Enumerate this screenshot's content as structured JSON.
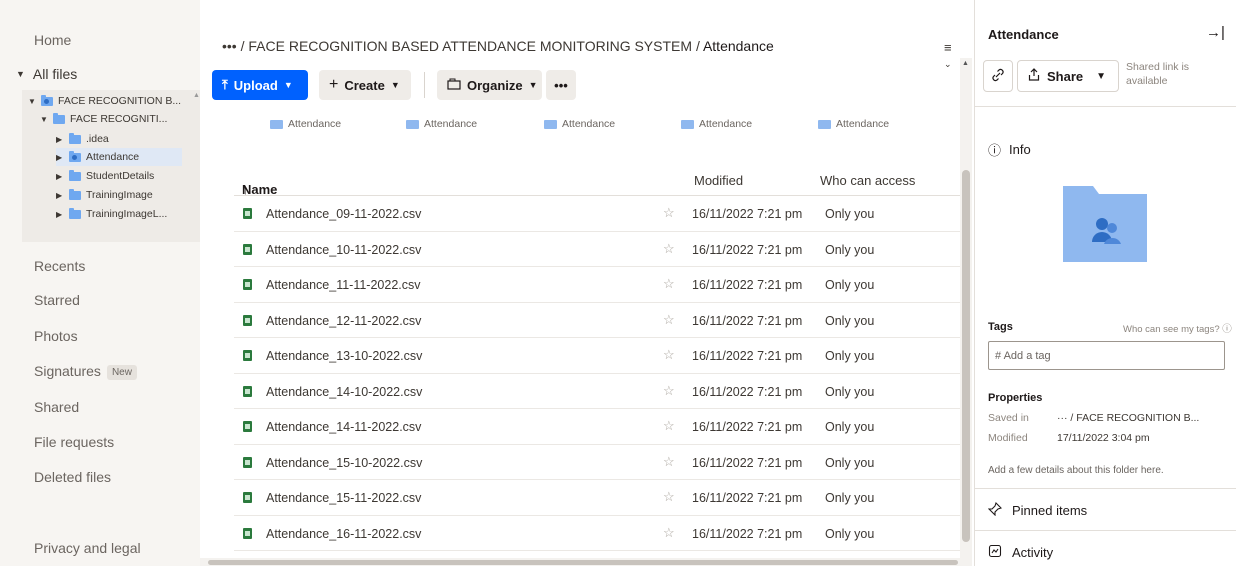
{
  "sidebar": {
    "home": "Home",
    "all_files": "All files",
    "tree": [
      {
        "label": "FACE RECOGNITION B...",
        "level": 0,
        "expanded": true,
        "shared": true
      },
      {
        "label": "FACE RECOGNITI...",
        "level": 1,
        "expanded": true,
        "shared": false
      },
      {
        "label": ".idea",
        "level": 2,
        "expanded": false,
        "shared": false
      },
      {
        "label": "Attendance",
        "level": 2,
        "expanded": false,
        "shared": true,
        "selected": true
      },
      {
        "label": "StudentDetails",
        "level": 2,
        "expanded": false,
        "shared": false
      },
      {
        "label": "TrainingImage",
        "level": 2,
        "expanded": false,
        "shared": false
      },
      {
        "label": "TrainingImageL...",
        "level": 2,
        "expanded": false,
        "shared": false
      }
    ],
    "recents": "Recents",
    "starred": "Starred",
    "photos": "Photos",
    "signatures": "Signatures",
    "signatures_badge": "New",
    "shared": "Shared",
    "file_requests": "File requests",
    "deleted_files": "Deleted files",
    "privacy": "Privacy and legal"
  },
  "breadcrumb": {
    "ellipsis": "•••",
    "parent": "FACE RECOGNITION BASED ATTENDANCE MONITORING SYSTEM",
    "separator": "/",
    "current": "Attendance"
  },
  "toolbar": {
    "upload": "Upload",
    "create": "Create",
    "organize": "Organize",
    "more": "•••",
    "view_icon": "≡"
  },
  "suggested": [
    "Attendance",
    "Attendance",
    "Attendance",
    "Attendance",
    "Attendance"
  ],
  "table": {
    "headers": {
      "name": "Name",
      "sort": "↑",
      "modified": "Modified",
      "access": "Who can access"
    },
    "rows": [
      {
        "name": "Attendance_09-11-2022.csv",
        "modified": "16/11/2022 7:21 pm",
        "access": "Only you"
      },
      {
        "name": "Attendance_10-11-2022.csv",
        "modified": "16/11/2022 7:21 pm",
        "access": "Only you"
      },
      {
        "name": "Attendance_11-11-2022.csv",
        "modified": "16/11/2022 7:21 pm",
        "access": "Only you"
      },
      {
        "name": "Attendance_12-11-2022.csv",
        "modified": "16/11/2022 7:21 pm",
        "access": "Only you"
      },
      {
        "name": "Attendance_13-10-2022.csv",
        "modified": "16/11/2022 7:21 pm",
        "access": "Only you"
      },
      {
        "name": "Attendance_14-10-2022.csv",
        "modified": "16/11/2022 7:21 pm",
        "access": "Only you"
      },
      {
        "name": "Attendance_14-11-2022.csv",
        "modified": "16/11/2022 7:21 pm",
        "access": "Only you"
      },
      {
        "name": "Attendance_15-10-2022.csv",
        "modified": "16/11/2022 7:21 pm",
        "access": "Only you"
      },
      {
        "name": "Attendance_15-11-2022.csv",
        "modified": "16/11/2022 7:21 pm",
        "access": "Only you"
      },
      {
        "name": "Attendance_16-11-2022.csv",
        "modified": "16/11/2022 7:21 pm",
        "access": "Only you"
      }
    ]
  },
  "panel": {
    "title": "Attendance",
    "collapse_icon": "→|",
    "share": "Share",
    "shared_note": "Shared link is available",
    "info": "Info",
    "tags_label": "Tags",
    "tags_help": "Who can see my tags?",
    "tag_placeholder": "# Add a tag",
    "properties_label": "Properties",
    "saved_in_key": "Saved in",
    "saved_in_value": "··· / FACE RECOGNITION B...",
    "modified_key": "Modified",
    "modified_value": "17/11/2022 3:04 pm",
    "add_details": "Add a few details about this folder here.",
    "pinned": "Pinned items",
    "activity": "Activity"
  },
  "colors": {
    "accent": "#0061fe",
    "folder": "#8fb8ef",
    "csv": "#2b7a3d"
  }
}
